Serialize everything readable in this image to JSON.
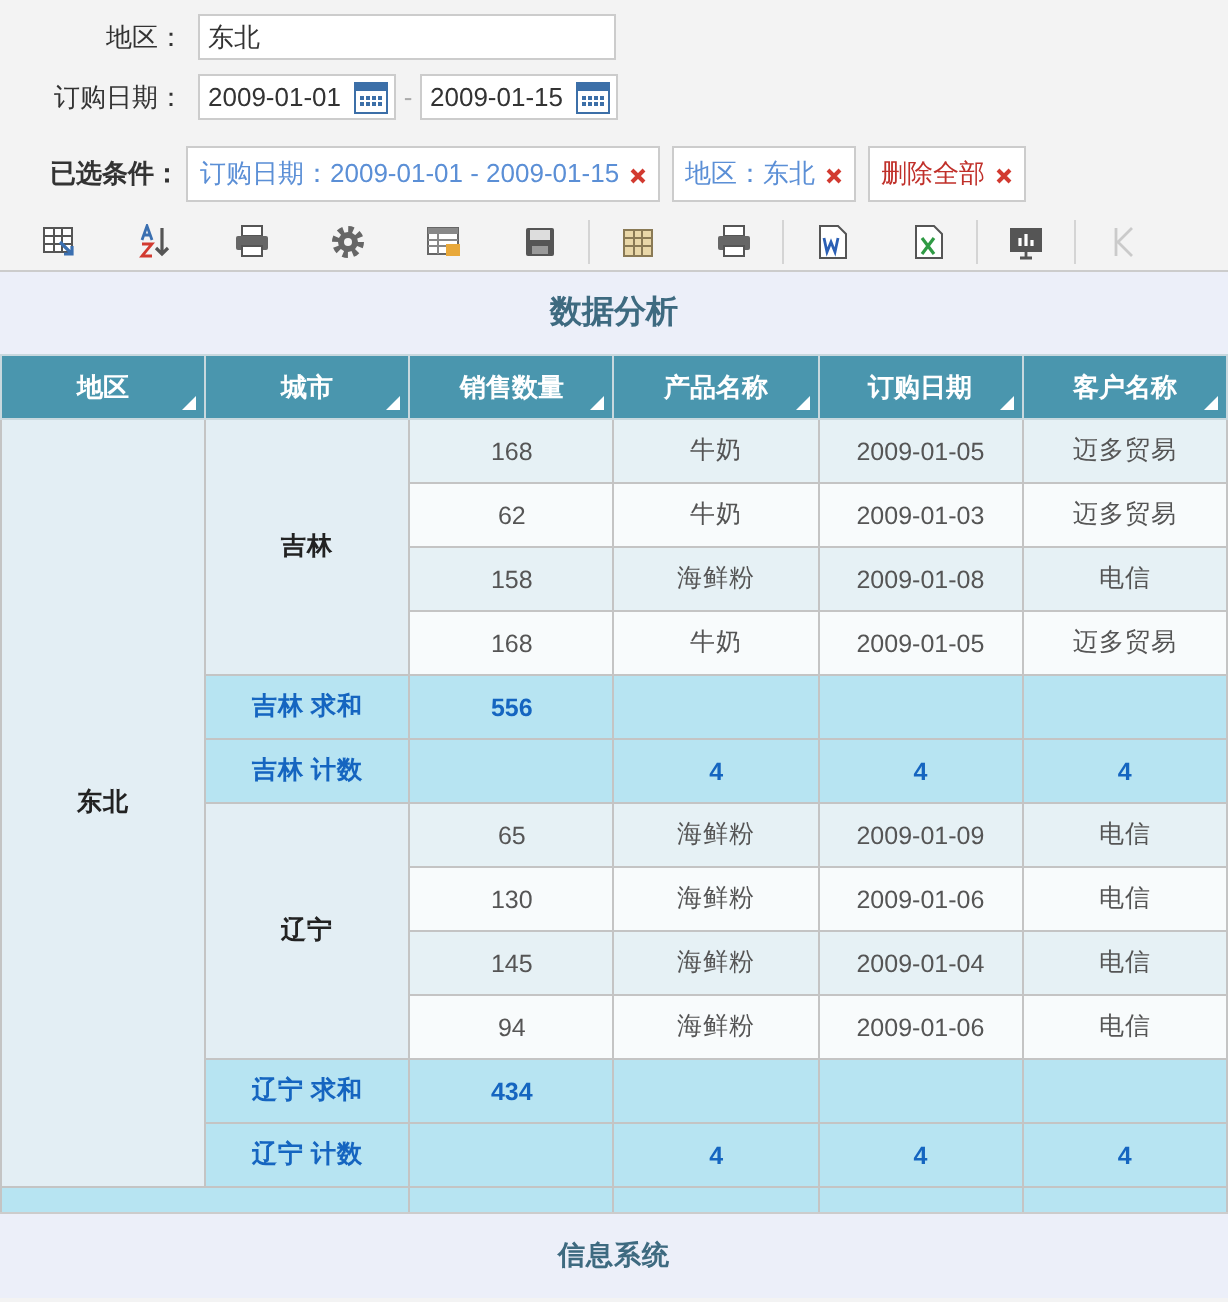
{
  "filters": {
    "region": {
      "label": "地区：",
      "value": "东北"
    },
    "date": {
      "label": "订购日期：",
      "from": "2009-01-01",
      "separator": "-",
      "to": "2009-01-15"
    },
    "conditions": {
      "label": "已选条件：",
      "chips": [
        {
          "kind": "condition",
          "text": "订购日期：2009-01-01 - 2009-01-15"
        },
        {
          "kind": "condition",
          "text": "地区：东北"
        },
        {
          "kind": "clear",
          "text": "删除全部"
        }
      ]
    }
  },
  "toolbar": {
    "items": [
      {
        "kind": "grid-arrow"
      },
      {
        "kind": "sort-az"
      },
      {
        "kind": "printer"
      },
      {
        "kind": "gear"
      },
      {
        "kind": "table-edit"
      },
      {
        "kind": "floppy"
      },
      {
        "kind": "separator"
      },
      {
        "kind": "columns"
      },
      {
        "kind": "printer"
      },
      {
        "kind": "separator"
      },
      {
        "kind": "word"
      },
      {
        "kind": "excel"
      },
      {
        "kind": "separator"
      },
      {
        "kind": "chart"
      },
      {
        "kind": "separator"
      },
      {
        "kind": "first-page",
        "disabled": true
      }
    ]
  },
  "report": {
    "title": "数据分析",
    "columns": [
      "地区",
      "城市",
      "销售数量",
      "产品名称",
      "订购日期",
      "客户名称"
    ],
    "regions": [
      {
        "name": "东北",
        "cities": [
          {
            "name": "吉林",
            "rows": [
              [
                "168",
                "牛奶",
                "2009-01-05",
                "迈多贸易"
              ],
              [
                "62",
                "牛奶",
                "2009-01-03",
                "迈多贸易"
              ],
              [
                "158",
                "海鲜粉",
                "2009-01-08",
                "电信"
              ],
              [
                "168",
                "牛奶",
                "2009-01-05",
                "迈多贸易"
              ]
            ],
            "summaries": [
              {
                "kind": "sum",
                "label": "吉林 求和",
                "value": "556"
              },
              {
                "kind": "count",
                "label": "吉林 计数",
                "values": [
                  "4",
                  "4",
                  "4"
                ]
              }
            ]
          },
          {
            "name": "辽宁",
            "rows": [
              [
                "65",
                "海鲜粉",
                "2009-01-09",
                "电信"
              ],
              [
                "130",
                "海鲜粉",
                "2009-01-06",
                "电信"
              ],
              [
                "145",
                "海鲜粉",
                "2009-01-04",
                "电信"
              ],
              [
                "94",
                "海鲜粉",
                "2009-01-06",
                "电信"
              ]
            ],
            "summaries": [
              {
                "kind": "sum",
                "label": "辽宁 求和",
                "value": "434"
              },
              {
                "kind": "count",
                "label": "辽宁 计数",
                "values": [
                  "4",
                  "4",
                  "4"
                ]
              }
            ]
          }
        ]
      }
    ],
    "footer": "信息系统"
  }
}
